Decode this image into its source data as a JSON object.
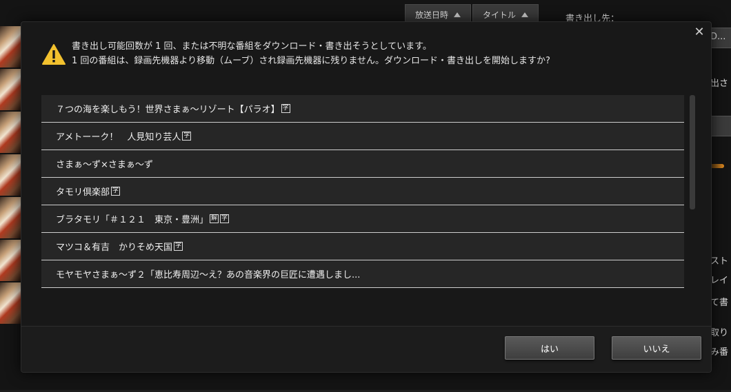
{
  "background": {
    "sort_buttons": [
      "放送日時",
      "タイトル"
    ],
    "dest_label": "書き出し先：",
    "right_fragments": [
      "D...",
      "出さ",
      "スト",
      "レイ",
      "て書",
      "取り",
      "み番"
    ]
  },
  "dialog": {
    "close_glyph": "✕",
    "message_line1": "書き出し可能回数が 1 回、または不明な番組をダウンロード・書き出そうとしています。",
    "message_line2": "1 回の番組は、録画先機器より移動（ムーブ）され録画先機器に残りません。ダウンロード・書き出しを開始しますか?",
    "programs": [
      {
        "title": "７つの海を楽しもう！世界さまぁ～リゾート【パラオ】",
        "badges": [
          "字"
        ]
      },
      {
        "title": "アメトーーク！　人見知り芸人",
        "badges": [
          "字"
        ]
      },
      {
        "title": "さまぁ～ず×さまぁ～ず",
        "badges": []
      },
      {
        "title": "タモリ倶楽部",
        "badges": [
          "字"
        ]
      },
      {
        "title": "ブラタモリ「＃１２１　東京・豊洲」",
        "badges": [
          "解",
          "字"
        ]
      },
      {
        "title": "マツコ＆有吉　かりそめ天国",
        "badges": [
          "字"
        ]
      },
      {
        "title": "モヤモヤさまぁ～ず２「恵比寿周辺～え？あの音楽界の巨匠に遭遇しまし...",
        "badges": []
      }
    ],
    "yes_label": "はい",
    "no_label": "いいえ"
  }
}
